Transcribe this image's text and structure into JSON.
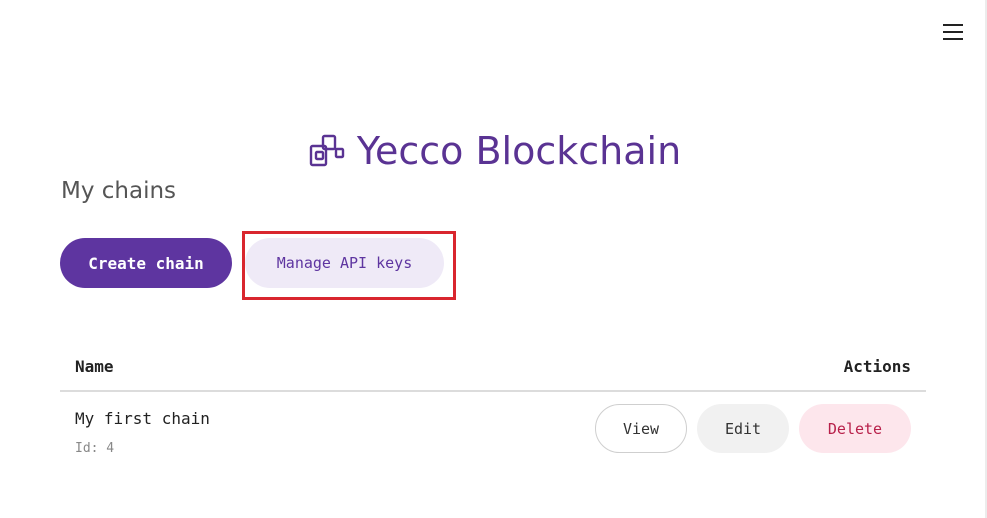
{
  "header": {
    "menu_icon": "hamburger-menu-icon"
  },
  "brand": {
    "icon": "blocks-icon",
    "title": "Yecco Blockchain",
    "color": "#5a3393"
  },
  "main": {
    "section_title": "My chains",
    "create_button_label": "Create chain",
    "manage_keys_button_label": "Manage API keys",
    "highlight_color": "#d9262e"
  },
  "table": {
    "columns": [
      "Name",
      "Actions"
    ],
    "rows": [
      {
        "name": "My first chain",
        "id_text": "Id: 4",
        "actions": {
          "view": "View",
          "edit": "Edit",
          "delete": "Delete"
        }
      }
    ]
  },
  "colors": {
    "primary": "#5e35a0",
    "primary_light": "#efeaf7",
    "danger_text": "#b8204a",
    "danger_bg": "#fde6ec"
  }
}
